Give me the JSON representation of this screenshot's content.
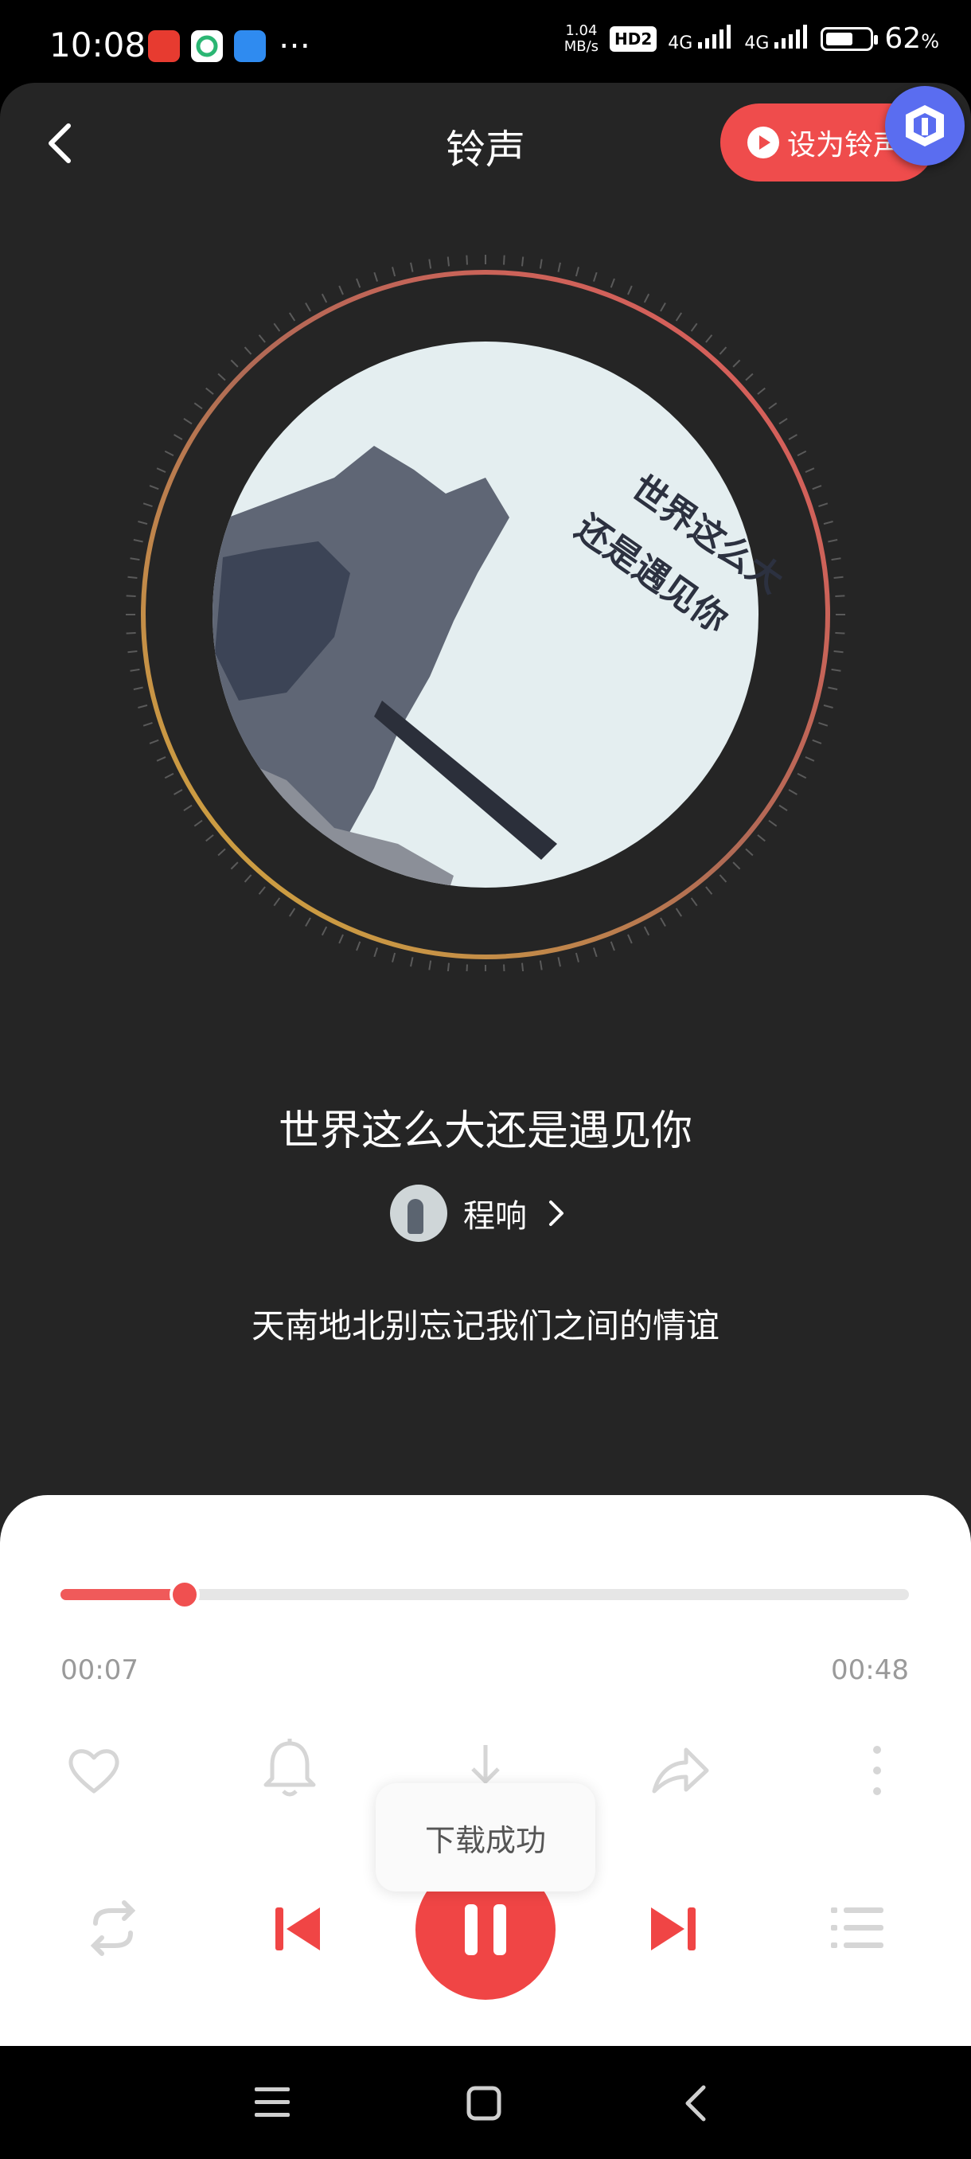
{
  "status_bar": {
    "time": "10:08",
    "net_speed_value": "1.04",
    "net_speed_unit": "MB/s",
    "hd_badge": "HD2",
    "signal_1": "4G",
    "signal_2": "4G",
    "battery_level": 0.62,
    "battery_percent": "62",
    "battery_percent_sign": "%",
    "more_icon": "…"
  },
  "header": {
    "title": "铃声",
    "set_ringtone_label": "设为铃声"
  },
  "song": {
    "title": "世界这么大还是遇见你",
    "artist": "程响",
    "lyric": "天南地北别忘记我们之间的情谊",
    "cover_text_line1": "世界这么大",
    "cover_text_line2": "还是遇见你"
  },
  "player": {
    "current_time": "00:07",
    "total_time": "00:48",
    "progress": 0.146,
    "toast": "下载成功"
  },
  "colors": {
    "accent": "#f04545",
    "panel_bg": "#252525",
    "sheet_bg": "#ffffff"
  },
  "icons": {
    "back": "chevron-left-icon",
    "like": "heart-icon",
    "ringtone": "bell-icon",
    "download": "download-icon",
    "share": "share-icon",
    "more": "more-vertical-icon",
    "loop": "repeat-icon",
    "prev": "skip-previous-icon",
    "pause": "pause-icon",
    "next": "skip-next-icon",
    "playlist": "playlist-icon"
  }
}
